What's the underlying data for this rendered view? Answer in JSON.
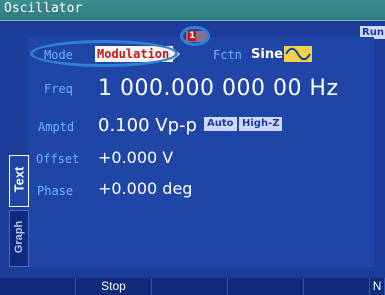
{
  "window": {
    "title": "Oscillator",
    "run_badge": "Run"
  },
  "channel_badge": {
    "prefix": "",
    "num": "1"
  },
  "mode": {
    "label": "Mode",
    "value": "Modulation"
  },
  "fctn": {
    "label": "Fctn",
    "value": "Sine",
    "icon": "sine-wave-icon"
  },
  "freq": {
    "label": "Freq",
    "value": "1 000.000 000 00 Hz"
  },
  "amptd": {
    "label": "Amptd",
    "value": "0.100 Vp-p",
    "chips": [
      {
        "label": "Auto"
      },
      {
        "label": "High-Z"
      }
    ]
  },
  "offset": {
    "label": "Offset",
    "value": "+0.000 V"
  },
  "phase": {
    "label": "Phase",
    "value": "+0.000 deg"
  },
  "tabs": [
    {
      "label": "Text"
    },
    {
      "label": "Graph"
    }
  ],
  "softkeys": [
    {
      "label": ""
    },
    {
      "label": "Stop"
    },
    {
      "label": ""
    },
    {
      "label": ""
    },
    {
      "label": ""
    },
    {
      "label": "N"
    }
  ],
  "colors": {
    "background": "#1b3d99",
    "label": "#6ab6ff",
    "value": "#ffffff",
    "accent_red": "#c8181a",
    "sine_icon_bg": "#f0d24a",
    "annotation": "#2f7fd6"
  }
}
